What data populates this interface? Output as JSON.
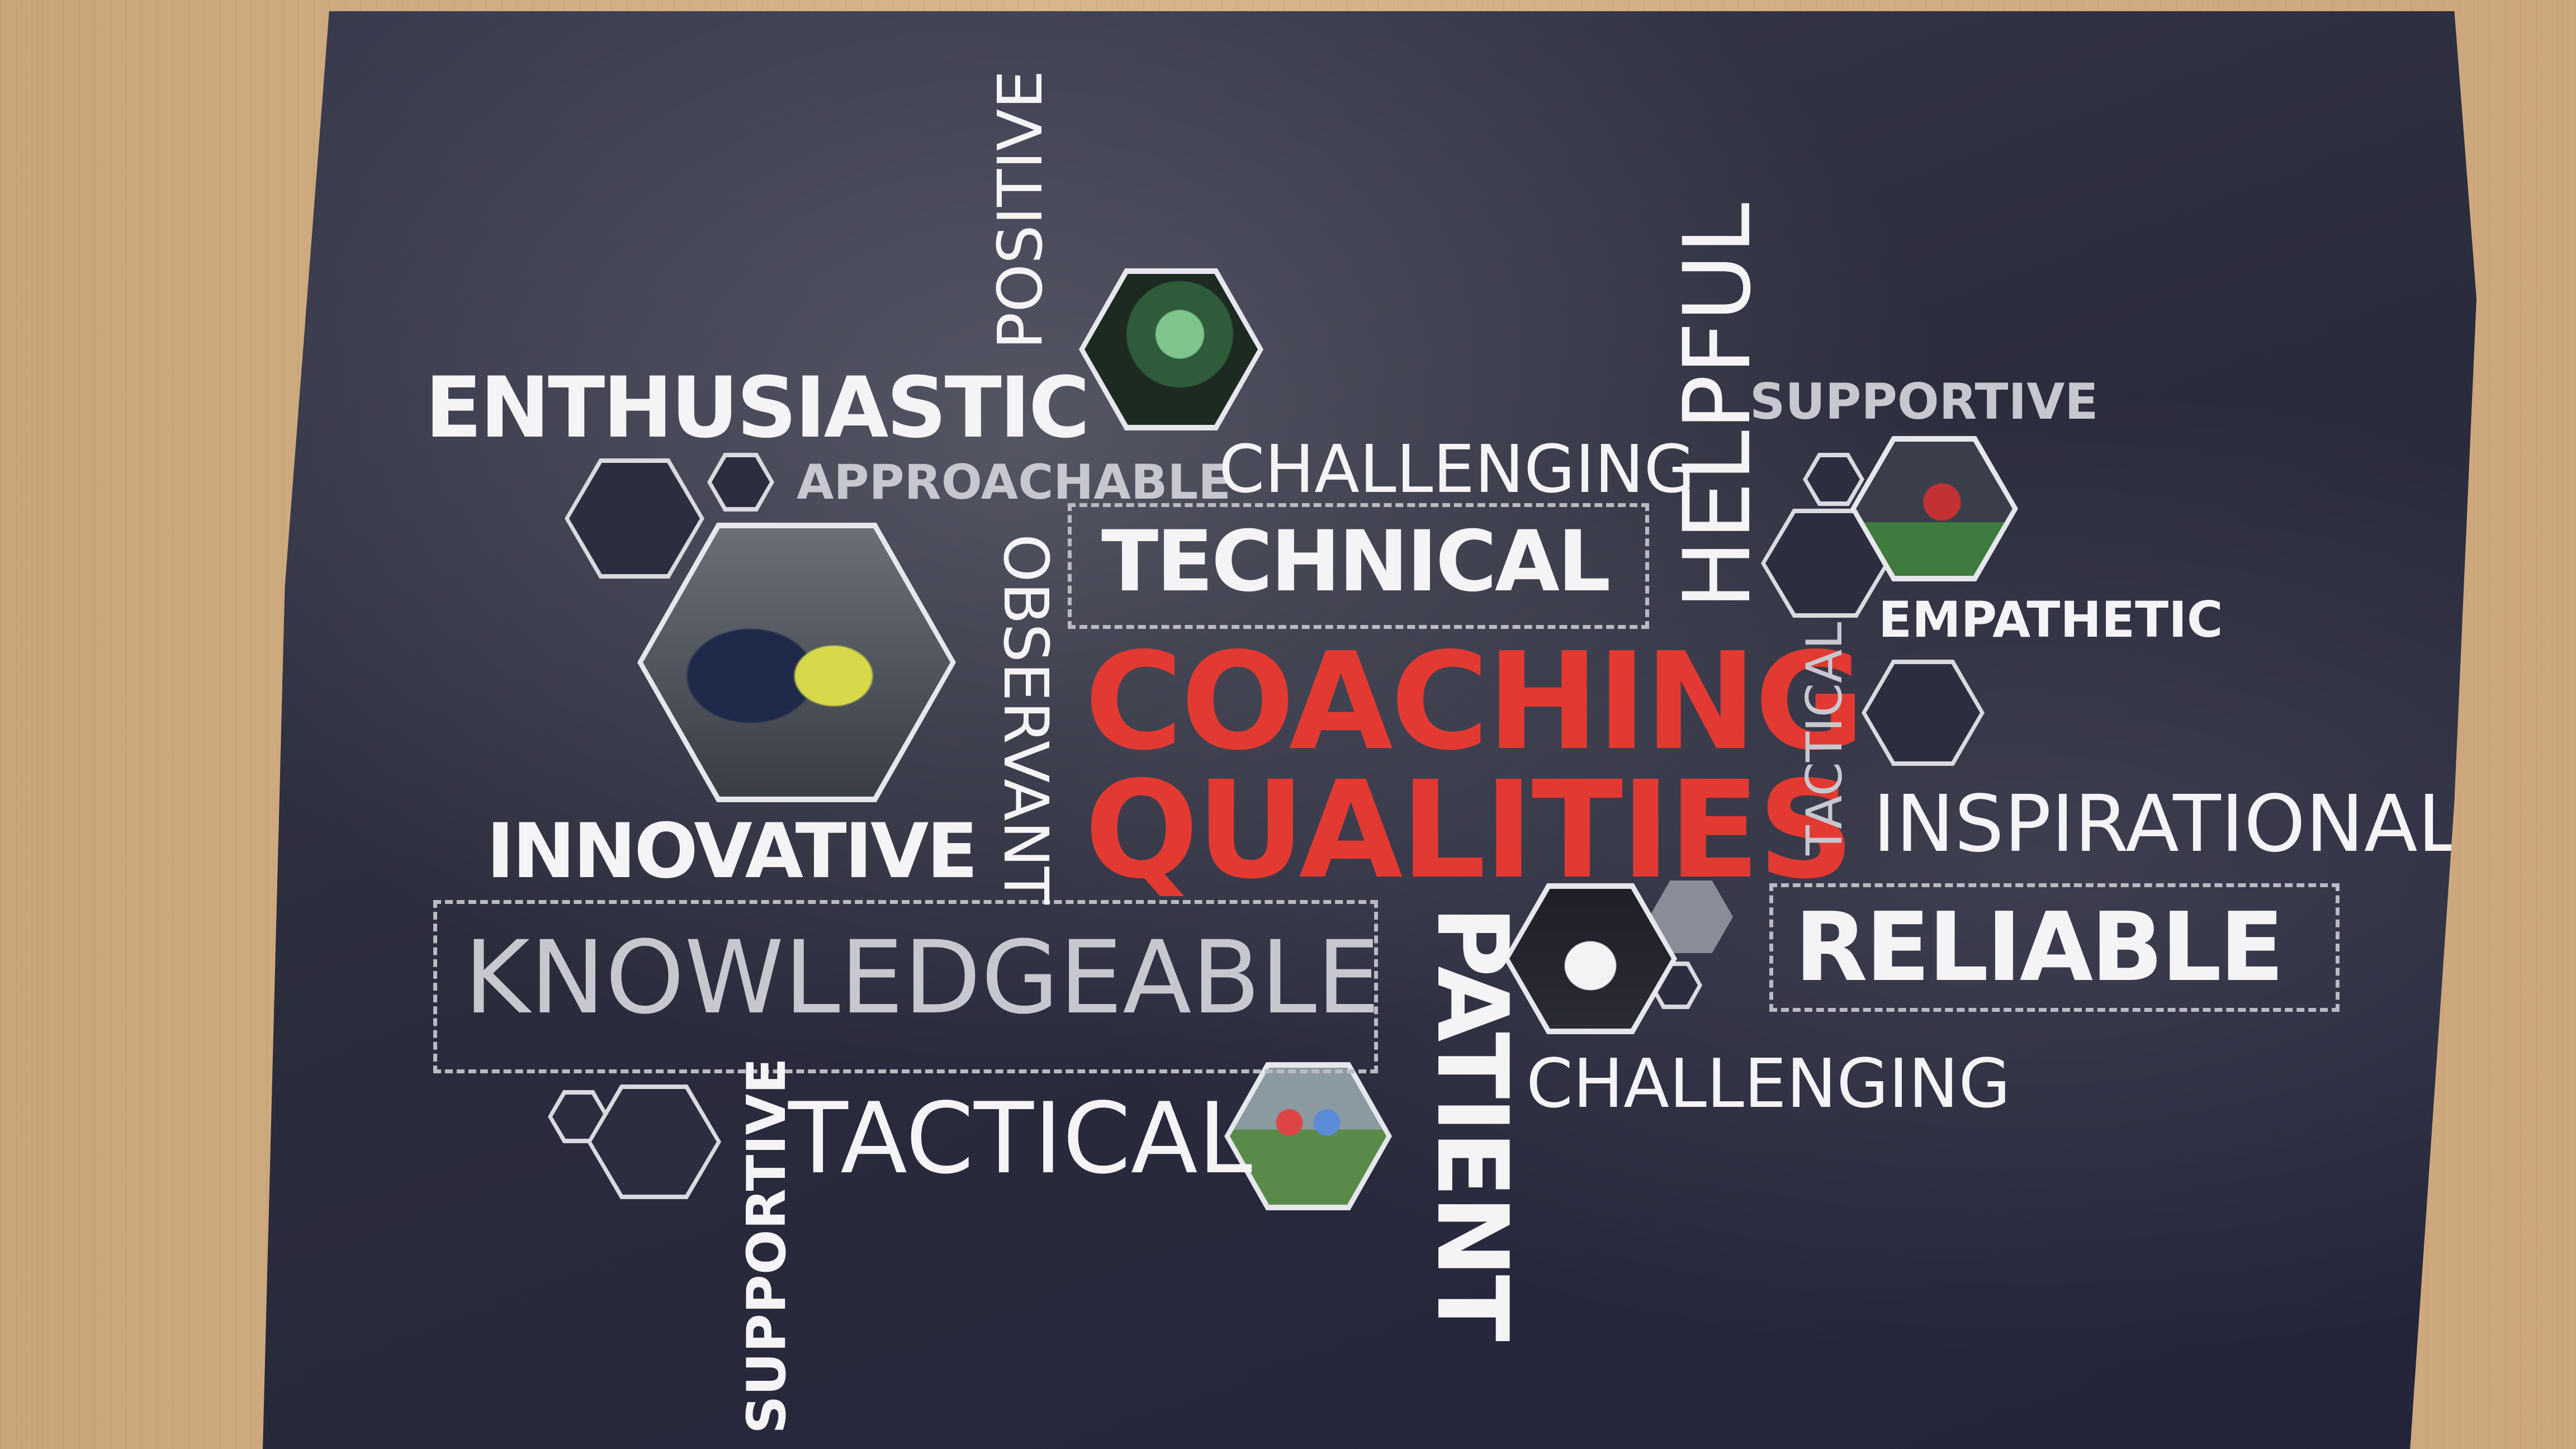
{
  "poster": {
    "title_line1": "COACHING",
    "title_line2": "QUALITIES",
    "words": {
      "enthusiastic": "ENTHUSIASTIC",
      "positive": "POSITIVE",
      "approachable": "APPROACHABLE",
      "challenging_top": "CHALLENGING",
      "technical": "TECHNICAL",
      "helpful": "HELPFUL",
      "supportive_top": "SUPPORTIVE",
      "empathetic": "EMPATHETIC",
      "observant": "OBSERVANT",
      "tactical_vertical": "TACTICAL",
      "inspirational": "INSPIRATIONAL",
      "innovative": "INNOVATIVE",
      "knowledgeable": "KNOWLEDGEABLE",
      "patient": "PATIENT",
      "reliable": "RELIABLE",
      "challenging_bottom": "CHALLENGING",
      "tactical_bottom": "TACTICAL",
      "supportive_bottom": "SUPPORTIVE"
    },
    "photos": [
      {
        "icon": "goalkeeper-photo"
      },
      {
        "icon": "coach-with-child-photo"
      },
      {
        "icon": "get-inspired-player-photo"
      },
      {
        "icon": "england-player-photo"
      },
      {
        "icon": "two-players-photo"
      }
    ],
    "colors": {
      "title_red": "#e23a32",
      "poster_navy": "#2b2c3c",
      "text_white": "#f4f4f6"
    }
  }
}
